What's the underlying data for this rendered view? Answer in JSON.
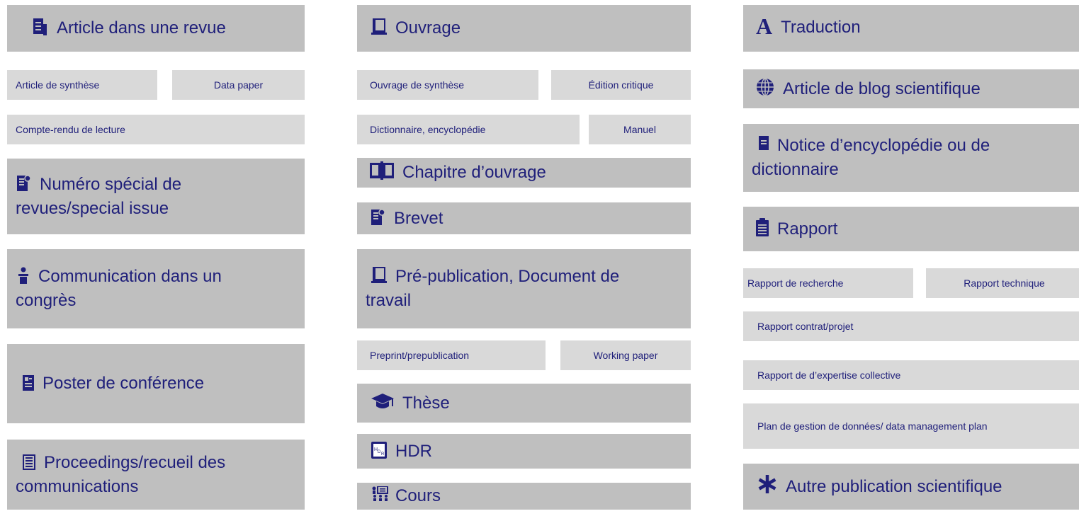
{
  "col1": {
    "article_revue": "Article dans une revue",
    "article_synthese": "Article de synthèse",
    "data_paper": "Data paper",
    "compte_rendu": "Compte-rendu de lecture",
    "numero_special": "Numéro spécial de revues/special issue",
    "communication": "Communication dans  un congrès",
    "poster": "Poster de conférence",
    "proceedings": "Proceedings/recueil des communications"
  },
  "col2": {
    "ouvrage": "Ouvrage",
    "ouvrage_synthese": "Ouvrage de synthèse",
    "edition_critique": "Édition critique",
    "dictionnaire": "Dictionnaire, encyclopédie",
    "manuel": "Manuel",
    "chapitre": "Chapitre d’ouvrage",
    "brevet": "Brevet",
    "prepublication": "Pré-publication, Document de travail",
    "preprint": "Preprint/prepublication",
    "working_paper": "Working paper",
    "these": "Thèse",
    "hdr": "HDR",
    "cours": "Cours"
  },
  "col3": {
    "traduction": "Traduction",
    "blog": "Article de blog scientifique",
    "notice": "Notice d’encyclopédie ou de dictionnaire",
    "rapport": "Rapport",
    "rapport_recherche": "Rapport de recherche",
    "rapport_technique": "Rapport technique",
    "rapport_contrat": "Rapport contrat/projet",
    "rapport_expertise": "Rapport de d’expertise collective",
    "plan_gestion": "Plan de gestion de données/ data management plan",
    "autre": "Autre publication scientifique"
  },
  "icons": {
    "article": "document-lines-icon",
    "ouvrage": "book-icon",
    "traduction": "letter-a-icon",
    "blog": "globe-icon",
    "notice": "small-document-icon",
    "numero": "document-badge-icon",
    "chapitre": "open-book-icon",
    "brevet": "document-badge-icon",
    "rapport": "clipboard-icon",
    "communication": "speaker-podium-icon",
    "prepublication": "book-icon",
    "poster": "poster-icon",
    "these": "graduation-cap-icon",
    "hdr": "hdr-icon",
    "proceedings": "newspaper-icon",
    "cours": "class-icon",
    "autre": "asterisk-icon"
  },
  "colors": {
    "main_box": "#bfbfbf",
    "sub_box": "#d9d9d9",
    "text": "#1f1f7a"
  }
}
